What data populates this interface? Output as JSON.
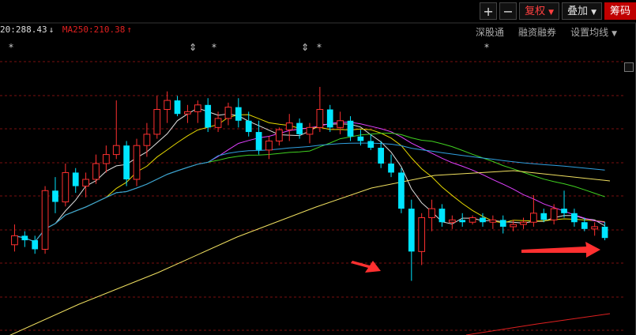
{
  "toolbar": {
    "zoom_in": "+",
    "zoom_out": "−",
    "restore_label": "复权",
    "overlay_label": "叠加",
    "chips_label": "筹码"
  },
  "ma_info": {
    "ma_prev_value": "20:288.43",
    "ma_prev_arrow": "↓",
    "ma250_label": "MA250:210.38",
    "ma250_arrow": "↑"
  },
  "links": {
    "hk_connect": "深股通",
    "margin": "融资融券",
    "ma_settings": "设置均线"
  },
  "colors": {
    "background": "#000000",
    "up": "#ff3030",
    "down": "#00e5ff",
    "grid": "#7a1010",
    "ma5": "#e0e0e0",
    "ma10": "#e6d800",
    "ma20": "#e040ff",
    "ma30": "#40d020",
    "ma60": "#30a0e0",
    "ma250_yellow": "#f0e060",
    "ma_red": "#e02020",
    "arrow": "#ff3030"
  },
  "chart_data": {
    "type": "candlestick",
    "title": "",
    "candles": [
      {
        "o": 286,
        "h": 295,
        "l": 283,
        "c": 290
      },
      {
        "o": 290,
        "h": 292,
        "l": 285,
        "c": 288
      },
      {
        "o": 288,
        "h": 290,
        "l": 282,
        "c": 284
      },
      {
        "o": 284,
        "h": 312,
        "l": 282,
        "c": 310
      },
      {
        "o": 310,
        "h": 316,
        "l": 300,
        "c": 305
      },
      {
        "o": 305,
        "h": 322,
        "l": 303,
        "c": 318
      },
      {
        "o": 318,
        "h": 320,
        "l": 309,
        "c": 312
      },
      {
        "o": 312,
        "h": 318,
        "l": 307,
        "c": 315
      },
      {
        "o": 315,
        "h": 326,
        "l": 313,
        "c": 322
      },
      {
        "o": 322,
        "h": 330,
        "l": 318,
        "c": 326
      },
      {
        "o": 326,
        "h": 350,
        "l": 324,
        "c": 330
      },
      {
        "o": 330,
        "h": 332,
        "l": 312,
        "c": 315
      },
      {
        "o": 315,
        "h": 333,
        "l": 312,
        "c": 330
      },
      {
        "o": 330,
        "h": 340,
        "l": 325,
        "c": 335
      },
      {
        "o": 335,
        "h": 352,
        "l": 333,
        "c": 346
      },
      {
        "o": 346,
        "h": 354,
        "l": 340,
        "c": 350
      },
      {
        "o": 350,
        "h": 352,
        "l": 343,
        "c": 344
      },
      {
        "o": 344,
        "h": 348,
        "l": 340,
        "c": 345
      },
      {
        "o": 345,
        "h": 350,
        "l": 340,
        "c": 348
      },
      {
        "o": 348,
        "h": 351,
        "l": 336,
        "c": 338
      },
      {
        "o": 338,
        "h": 345,
        "l": 336,
        "c": 342
      },
      {
        "o": 342,
        "h": 349,
        "l": 339,
        "c": 347
      },
      {
        "o": 347,
        "h": 351,
        "l": 338,
        "c": 341
      },
      {
        "o": 341,
        "h": 345,
        "l": 334,
        "c": 336
      },
      {
        "o": 336,
        "h": 341,
        "l": 326,
        "c": 328
      },
      {
        "o": 328,
        "h": 334,
        "l": 324,
        "c": 332
      },
      {
        "o": 332,
        "h": 338,
        "l": 330,
        "c": 337
      },
      {
        "o": 337,
        "h": 344,
        "l": 332,
        "c": 340
      },
      {
        "o": 340,
        "h": 342,
        "l": 333,
        "c": 335
      },
      {
        "o": 335,
        "h": 340,
        "l": 331,
        "c": 338
      },
      {
        "o": 338,
        "h": 356,
        "l": 336,
        "c": 346
      },
      {
        "o": 346,
        "h": 348,
        "l": 336,
        "c": 338
      },
      {
        "o": 338,
        "h": 345,
        "l": 335,
        "c": 341
      },
      {
        "o": 341,
        "h": 343,
        "l": 332,
        "c": 334
      },
      {
        "o": 334,
        "h": 337,
        "l": 330,
        "c": 332
      },
      {
        "o": 332,
        "h": 335,
        "l": 328,
        "c": 329
      },
      {
        "o": 329,
        "h": 332,
        "l": 320,
        "c": 322
      },
      {
        "o": 322,
        "h": 326,
        "l": 316,
        "c": 318
      },
      {
        "o": 318,
        "h": 320,
        "l": 300,
        "c": 302
      },
      {
        "o": 302,
        "h": 306,
        "l": 270,
        "c": 283
      },
      {
        "o": 283,
        "h": 300,
        "l": 277,
        "c": 298
      },
      {
        "o": 298,
        "h": 306,
        "l": 292,
        "c": 302
      },
      {
        "o": 302,
        "h": 304,
        "l": 294,
        "c": 296
      },
      {
        "o": 296,
        "h": 299,
        "l": 293,
        "c": 297
      },
      {
        "o": 297,
        "h": 300,
        "l": 294,
        "c": 296
      },
      {
        "o": 296,
        "h": 299,
        "l": 295,
        "c": 298
      },
      {
        "o": 298,
        "h": 300,
        "l": 294,
        "c": 296
      },
      {
        "o": 296,
        "h": 299,
        "l": 293,
        "c": 297
      },
      {
        "o": 297,
        "h": 299,
        "l": 291,
        "c": 294
      },
      {
        "o": 294,
        "h": 297,
        "l": 292,
        "c": 295
      },
      {
        "o": 295,
        "h": 298,
        "l": 293,
        "c": 296
      },
      {
        "o": 296,
        "h": 308,
        "l": 294,
        "c": 300
      },
      {
        "o": 300,
        "h": 302,
        "l": 296,
        "c": 297
      },
      {
        "o": 297,
        "h": 304,
        "l": 295,
        "c": 302
      },
      {
        "o": 302,
        "h": 310,
        "l": 298,
        "c": 300
      },
      {
        "o": 300,
        "h": 302,
        "l": 294,
        "c": 296
      },
      {
        "o": 296,
        "h": 298,
        "l": 292,
        "c": 293
      },
      {
        "o": 293,
        "h": 296,
        "l": 290,
        "c": 294
      },
      {
        "o": 294,
        "h": 296,
        "l": 288,
        "c": 289
      }
    ],
    "ma250_label": "MA250",
    "ma250_value": 210.38,
    "grid": true
  }
}
